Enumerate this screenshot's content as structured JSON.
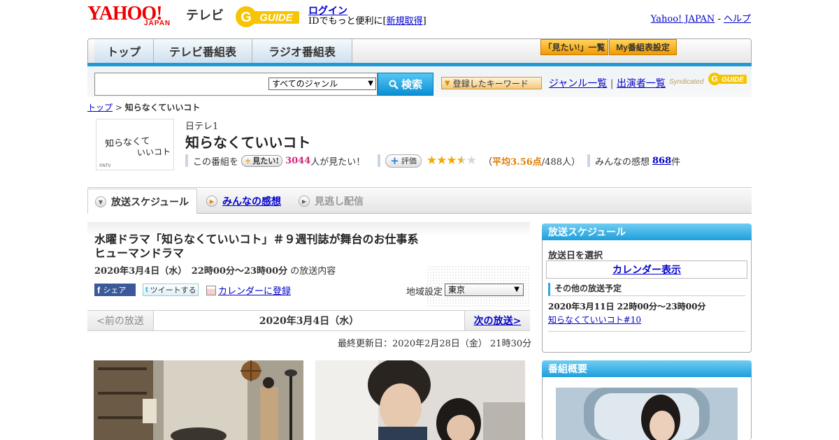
{
  "header": {
    "logo_yahoo": "YAHOO!",
    "logo_japan": "JAPAN",
    "logo_terebi": "テレビ",
    "logo_gguide": "G-GUIDE",
    "login": "ログイン",
    "id_text": "IDでもっと便利に[",
    "register": "新規取得",
    "id_close": "]",
    "yahoo_japan_link": "Yahoo! JAPAN",
    "separator": " - ",
    "help_link": "ヘルプ"
  },
  "nav": {
    "tabs": [
      "トップ",
      "テレビ番組表",
      "ラジオ番組表"
    ],
    "mitai_list": "「見たい!」一覧",
    "my_schedule": "My番組表設定"
  },
  "search": {
    "genre_selected": "すべてのジャンル",
    "button": "検索",
    "keyword_button": "登録したキーワード",
    "genre_list": "ジャンル一覧",
    "pipe": "|",
    "performer_list": "出演者一覧",
    "syndicated": "Syndicated"
  },
  "breadcrumb": {
    "top": "トップ",
    "sep": " > ",
    "current": "知らなくていいコト"
  },
  "program": {
    "thumb_line1": "知らなくて",
    "thumb_line2": "いいコト",
    "thumb_copyright": "©NTV",
    "station": "日テレ1",
    "title": "知らなくていいコト",
    "this_program": "この番組を",
    "mitai_btn": "見たい!",
    "mitai_count": "3044",
    "mitai_suffix": "人が見たい！",
    "hyoka_btn": "評価",
    "rating": 3.56,
    "avg_prefix": "（",
    "avg_label": "平均3.56点",
    "avg_suffix": "/488人）",
    "impressions_label": "みんなの感想",
    "impressions_count": "868",
    "impressions_suffix": "件"
  },
  "tabs": {
    "schedule": "放送スケジュール",
    "impressions": "みんなの感想",
    "vod": "見逃し配信"
  },
  "episode": {
    "title": "水曜ドラマ「知らなくていいコト」＃９週刊誌が舞台のお仕事系ヒューマンドラマ",
    "date": "2020年3月4日（水）　22時00分～23時00分",
    "date_suffix": " の放送内容",
    "share_fb": "シェア",
    "share_tw": "ツイートする",
    "calendar_register": "カレンダーに登録",
    "region_label": "地域設定",
    "region_value": "東京",
    "prev": "<前の放送",
    "current_date": "2020年3月4日（水）",
    "next": "次の放送>",
    "updated": "最終更新日：2020年2月28日（金） 21時30分"
  },
  "sidebar": {
    "schedule_head": "放送スケジュール",
    "select_date": "放送日を選択",
    "calendar_btn": "カレンダー表示",
    "other_head": "その他の放送予定",
    "other_date": "2020年3月11日 22時00分～23時00分",
    "other_link": "知らなくていいコト#10",
    "overview_head": "番組概要"
  },
  "colors": {
    "accent_blue": "#1f9ad6",
    "yahoo_red": "#e00000",
    "pink_count": "#d6237a",
    "star_gold": "#f2a900"
  }
}
